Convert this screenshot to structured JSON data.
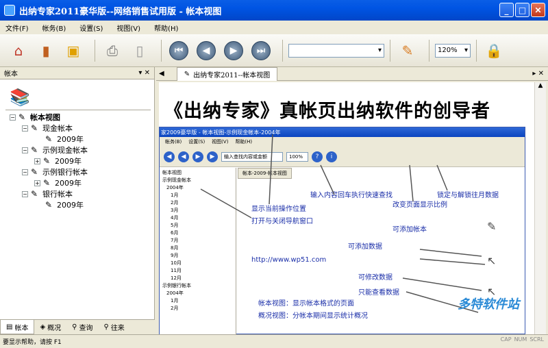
{
  "window": {
    "title": "出纳专家2011豪华版--网络销售试用版 - 帐本视图"
  },
  "menu": [
    "文件(F)",
    "帐务(B)",
    "设置(S)",
    "视图(V)",
    "帮助(H)"
  ],
  "toolbar": {
    "zoom": "120%"
  },
  "left_panel": {
    "title": "帐本"
  },
  "tree": [
    {
      "label": "帐本视图",
      "level": 0,
      "expander": "−",
      "bold": true
    },
    {
      "label": "现金帐本",
      "level": 1,
      "expander": "−"
    },
    {
      "label": "2009年",
      "level": 2,
      "expander": ""
    },
    {
      "label": "示例现金帐本",
      "level": 1,
      "expander": "−"
    },
    {
      "label": "2009年",
      "level": 2,
      "expander": "+"
    },
    {
      "label": "示例银行帐本",
      "level": 1,
      "expander": "−"
    },
    {
      "label": "2009年",
      "level": 2,
      "expander": "+"
    },
    {
      "label": "银行帐本",
      "level": 1,
      "expander": "−"
    },
    {
      "label": "2009年",
      "level": 2,
      "expander": ""
    }
  ],
  "bottom_tabs": [
    "帐本",
    "概况",
    "查询",
    "往来"
  ],
  "doc_tab": "出纳专家2011--帐本视图",
  "content": {
    "headline": "《出纳专家》真帐页出纳软件的创导者",
    "inner_title": "家2009豪华版 - 帐本视图-示例现金帐本-2004年",
    "inner_menu": [
      "帐务(B)",
      "设置(S)",
      "视图(V)",
      "帮助(H)"
    ],
    "inner_search": "输入查找内容或金额",
    "inner_zoom": "100%",
    "inner_tab": "帐本-2009-帐本视图",
    "inner_tree": [
      "帐本视图",
      "示例现金帐本",
      "2004年",
      "1月",
      "2月",
      "3月",
      "4月",
      "5月",
      "6月",
      "7月",
      "8月",
      "9月",
      "10月",
      "11月",
      "12月",
      "示例银行帐本",
      "2004年",
      "1月",
      "2月"
    ],
    "annotations": [
      "输入内容回车执行快速查找",
      "锁定与解锁往月数据",
      "改变页面显示比例",
      "显示当前操作位置",
      "打开与关闭导航窗口",
      "可添加帐本",
      "可添加数据",
      "http://www.wp51.com",
      "可修改数据",
      "只能查看数据",
      "帐本视图：显示帐本格式的页面",
      "概况视图：分帐本期间显示统计概况"
    ]
  },
  "status": "要显示帮助，请按 F1",
  "status_keys": [
    "CAP",
    "NUM",
    "SCRL"
  ],
  "watermark": "多特软件站"
}
